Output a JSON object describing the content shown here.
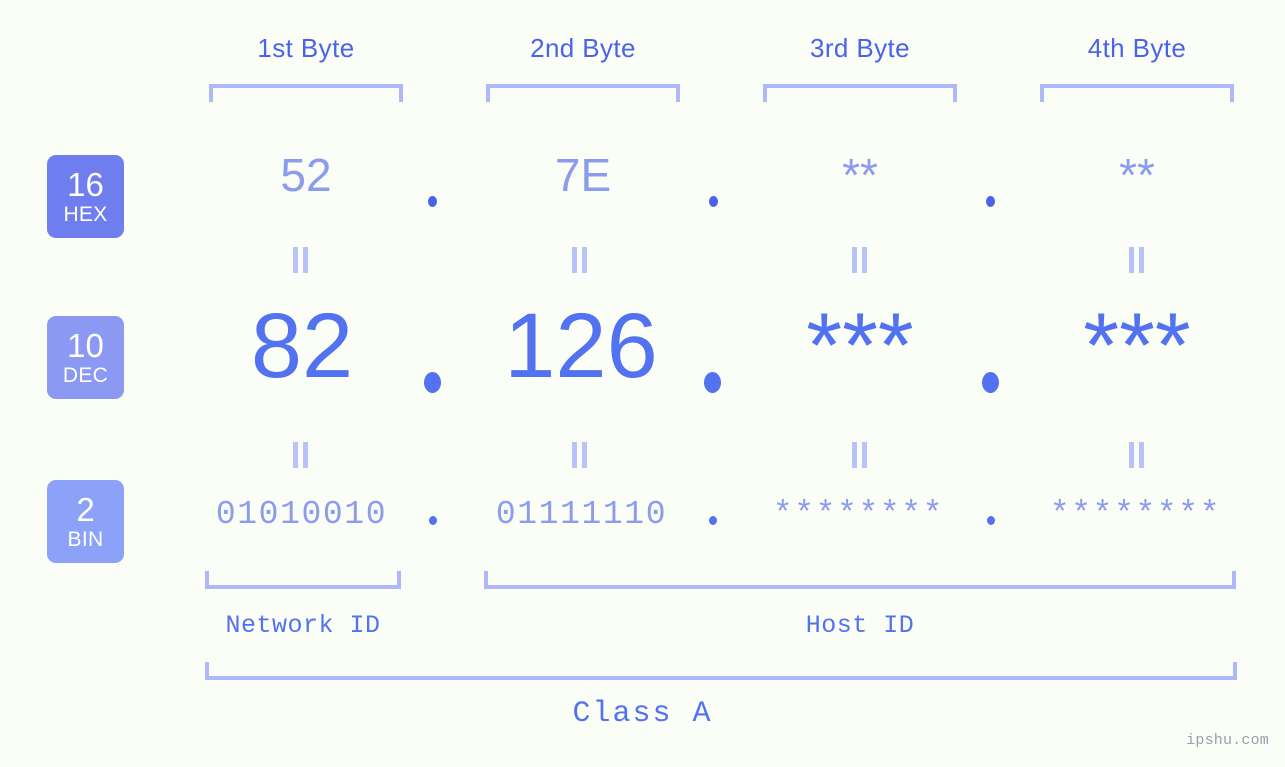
{
  "background_color": "#fbfdf7",
  "colors": {
    "header_blue": "#4a63ea",
    "bracket_blue": "#aeb7f7",
    "dec_blue": "#5272f0",
    "muted_blue": "#8b9cef",
    "badge_hex": "#6f7eee",
    "badge_dec": "#8c99f2",
    "badge_bin": "#8ba2f8",
    "eq_blue": "#b9c2f8",
    "watermark_gray": "#9aa0ad"
  },
  "byte_headers": [
    {
      "label": "1st Byte"
    },
    {
      "label": "2nd Byte"
    },
    {
      "label": "3rd Byte"
    },
    {
      "label": "4th Byte"
    }
  ],
  "badges": [
    {
      "num": "16",
      "abbr": "HEX"
    },
    {
      "num": "10",
      "abbr": "DEC"
    },
    {
      "num": "2",
      "abbr": "BIN"
    }
  ],
  "rows": {
    "hex": {
      "values": [
        "52",
        "7E",
        "**",
        "**"
      ]
    },
    "dec": {
      "values": [
        "82",
        "126",
        "***",
        "***"
      ]
    },
    "bin": {
      "values": [
        "01010010",
        "01111110",
        "********",
        "********"
      ]
    }
  },
  "separator": ".",
  "equality_mark": "=",
  "id_labels": [
    {
      "label": "Network ID"
    },
    {
      "label": "Host ID"
    }
  ],
  "class_label": "Class A",
  "watermark": "ipshu.com"
}
